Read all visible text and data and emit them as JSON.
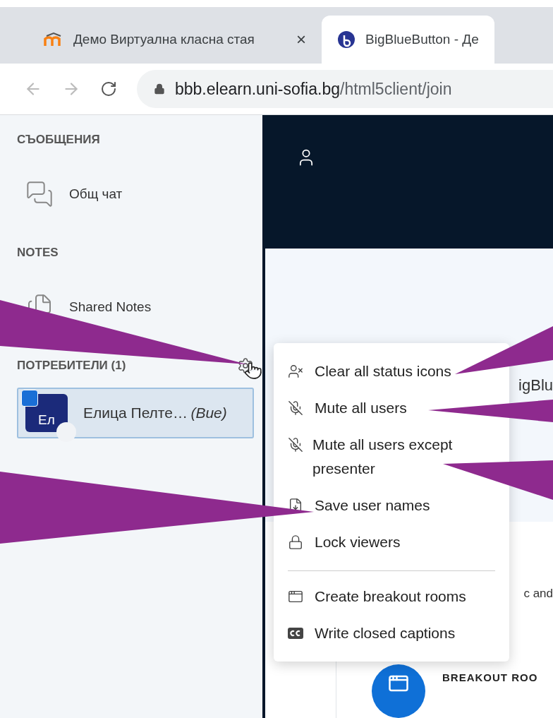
{
  "browser": {
    "tabs": [
      {
        "title": "Демо Виртуална класна стая",
        "close": "×",
        "selected": false
      },
      {
        "title": "BigBlueButton - Де",
        "selected": true
      }
    ],
    "address": {
      "host": "bbb.elearn.uni-sofia.bg",
      "path": "/html5client/join"
    }
  },
  "sidebar": {
    "sections": [
      {
        "heading": "СЪОБЩЕНИЯ",
        "items": [
          {
            "kind": "chat",
            "label": "Общ чат"
          }
        ]
      },
      {
        "heading": "NOTES",
        "items": [
          {
            "kind": "notes",
            "label": "Shared Notes"
          }
        ]
      }
    ],
    "users": {
      "heading": "ПОТРЕБИТЕЛИ (1)",
      "list": [
        {
          "initials": "Ел",
          "name": "Елица Пелте…",
          "suffix": "(Вие)",
          "presenter": true,
          "selected": true
        }
      ]
    }
  },
  "menu": {
    "groups": [
      {
        "items": [
          {
            "kind": "clear-status",
            "label": "Clear all status icons"
          },
          {
            "kind": "mute",
            "label": "Mute all users"
          },
          {
            "kind": "mute",
            "label": "Mute all users except presenter"
          },
          {
            "kind": "save",
            "label": "Save user names"
          },
          {
            "kind": "lock",
            "label": "Lock viewers"
          }
        ]
      },
      {
        "items": [
          {
            "kind": "breakout",
            "label": "Create breakout rooms"
          },
          {
            "kind": "captions",
            "label": "Write closed captions"
          }
        ]
      }
    ]
  },
  "main": {
    "fragments": [
      "igBlu",
      "c and"
    ],
    "breakout": {
      "heading": "BREAKOUT ROO"
    }
  }
}
